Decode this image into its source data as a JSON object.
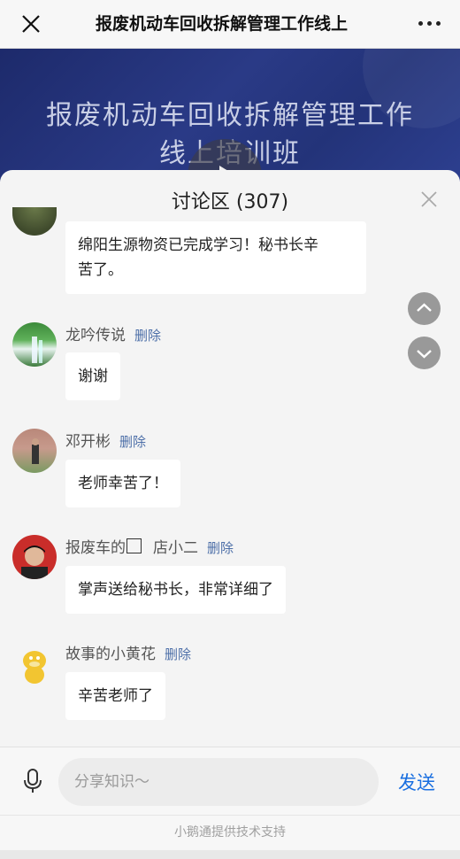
{
  "top_bar": {
    "title": "报废机动车回收拆解管理工作线上",
    "close_icon": "close-icon",
    "more_icon": "more-dots-icon"
  },
  "video": {
    "line1": "报废机动车回收拆解管理工作",
    "line2": "线上培训班",
    "play_icon": "play-icon"
  },
  "discussion": {
    "title": "讨论区 (307)",
    "close_icon": "close-icon",
    "messages": [
      {
        "user": "",
        "text_line1": "绵阳生源物资已完成学习！秘书长辛",
        "text_line2": "苦了。"
      },
      {
        "user": "龙吟传说",
        "delete": "删除",
        "text": "谢谢"
      },
      {
        "user": "邓开彬",
        "delete": "删除",
        "text": "老师幸苦了！"
      },
      {
        "user_part1": "报废车的",
        "user_part2": "店小二",
        "delete": "删除",
        "text": "掌声送给秘书长，非常详细了"
      },
      {
        "user": "故事的小黄花",
        "delete": "删除",
        "text": "辛苦老师了"
      }
    ],
    "scroll_up_icon": "chevron-up-icon",
    "scroll_down_icon": "chevron-down-icon"
  },
  "composer": {
    "placeholder": "分享知识～",
    "send_label": "发送",
    "mic_icon": "microphone-icon"
  },
  "footer": {
    "text": "小鹅通提供技术支持"
  },
  "colors": {
    "accent": "#1a6fe0",
    "delete_link": "#4d6fa8"
  }
}
